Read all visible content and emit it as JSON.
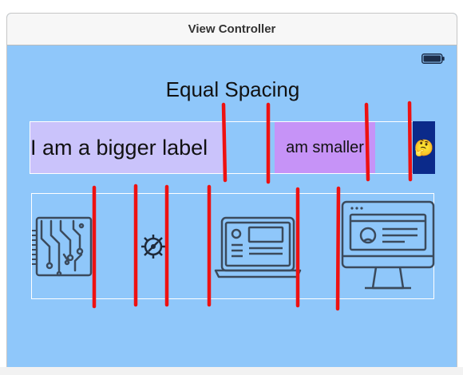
{
  "window": {
    "title": "View Controller"
  },
  "heading": "Equal Spacing",
  "labels": {
    "bigger": "I am a bigger label",
    "smaller": "am smaller",
    "emoji": "🤔"
  },
  "colors": {
    "view_background": "#8fc7fa",
    "big_label_bg": "#cac3fb",
    "small_label_bg": "#c693f7",
    "emoji_label_bg": "#0b2a8a",
    "marker": "#ee1111"
  },
  "icons": [
    "battery-icon",
    "circuit-board-icon",
    "gear-icon",
    "laptop-icon",
    "monitor-profile-icon"
  ]
}
